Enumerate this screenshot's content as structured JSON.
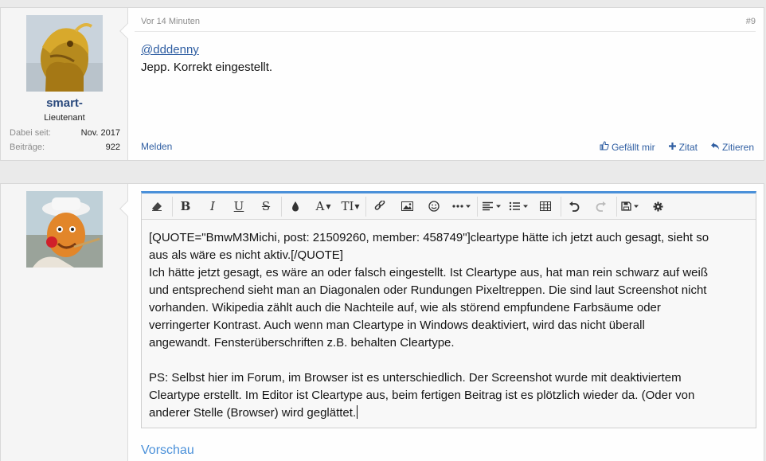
{
  "post1": {
    "username": "smart-",
    "usertitle": "Lieutenant",
    "stats": [
      {
        "key": "Dabei seit:",
        "value": "Nov. 2017"
      },
      {
        "key": "Beiträge:",
        "value": "922"
      }
    ],
    "time": "Vor 14 Minuten",
    "number": "#9",
    "mention": "@dddenny",
    "text": "Jepp. Korrekt eingestellt.",
    "report": "Melden",
    "actions": [
      {
        "icon": "thumbs-up-icon",
        "label": "Gefällt mir"
      },
      {
        "icon": "plus-icon",
        "label": "Zitat"
      },
      {
        "icon": "reply-icon",
        "label": "Zitieren"
      }
    ]
  },
  "editor": {
    "toolbar": [
      "eraser-icon",
      "bold-icon",
      "italic-icon",
      "underline-icon",
      "strikethrough-icon",
      "color-drop-icon",
      "font-family-icon",
      "font-size-icon",
      "link-icon",
      "image-icon",
      "smiley-icon",
      "more-icon",
      "align-icon",
      "list-icon",
      "table-icon",
      "undo-icon",
      "redo-icon",
      "save-icon",
      "gear-icon"
    ],
    "lines": [
      "[QUOTE=\"BmwM3Michi, post: 21509260, member: 458749\"]cleartype hätte ich jetzt auch gesagt, sieht so",
      "aus als wäre es nicht aktiv.[/QUOTE]",
      "Ich hätte jetzt gesagt, es wäre an oder falsch eingestellt. Ist Cleartype aus, hat man rein schwarz auf weiß",
      "und entsprechend sieht man an Diagonalen oder Rundungen Pixeltreppen. Die sind laut Screenshot nicht",
      "vorhanden. Wikipedia zählt auch die Nachteile auf, wie als störend empfundene Farbsäume oder",
      "verringerter Kontrast. Auch wenn man Cleartype in Windows deaktiviert, wird das nicht überall",
      "angewandt. Fensterüberschriften z.B. behalten Cleartype.",
      "",
      "PS: Selbst hier im Forum, im Browser ist es unterschiedlich. Der Screenshot wurde mit deaktiviertem",
      "Cleartype erstellt. Im Editor ist Cleartype aus, beim fertigen Beitrag ist es plötzlich wieder da. (Oder von",
      "anderer Stelle (Browser) wird geglättet."
    ]
  },
  "preview_label": "Vorschau",
  "colors": {
    "accent": "#4a90d9",
    "link": "#2f5ea2",
    "username": "#2b4a7d"
  }
}
